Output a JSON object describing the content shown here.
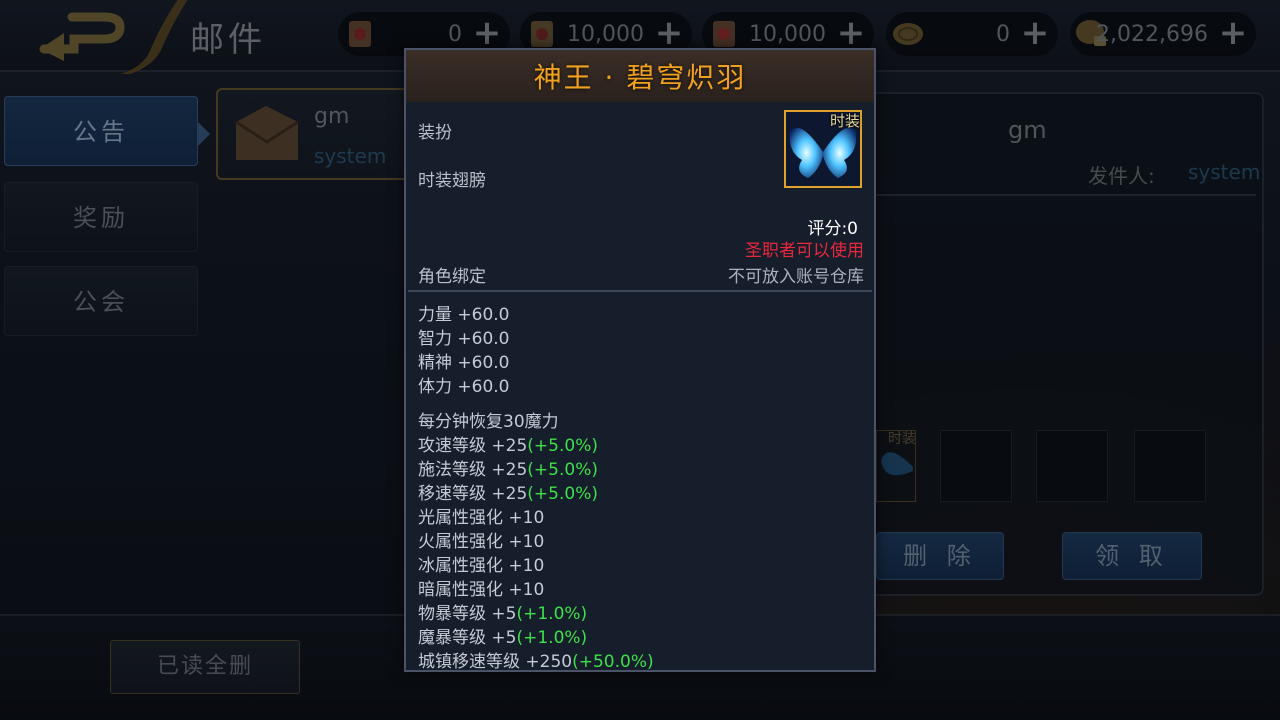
{
  "header": {
    "title": "邮件",
    "currencies": [
      {
        "icon": "scroll-red-icon",
        "value": "0"
      },
      {
        "icon": "scroll-gold-icon",
        "value": "10,000"
      },
      {
        "icon": "scroll-seal-icon",
        "value": "10,000"
      },
      {
        "icon": "coin-bronze-icon",
        "value": "0"
      },
      {
        "icon": "coin-lock-icon",
        "value": "2,022,696"
      }
    ],
    "plus": "+"
  },
  "tabs": [
    {
      "label": "公告",
      "active": true
    },
    {
      "label": "奖励",
      "active": false
    },
    {
      "label": "公会",
      "active": false
    }
  ],
  "mail_list": [
    {
      "title": "gm",
      "sender": "system"
    }
  ],
  "detail": {
    "title": "gm",
    "sender_label": "发件人:",
    "sender": "system",
    "attachment_tag": "时装",
    "delete_label": "删 除",
    "claim_label": "领 取"
  },
  "bottom": {
    "read_delete_label": "已读全删"
  },
  "tooltip": {
    "name": "神王 · 碧穹炽羽",
    "category": "装扮",
    "subtype": "时装翅膀",
    "icon_tag": "时装",
    "score": "评分:0",
    "class_req": "圣职者可以使用",
    "binding": "角色绑定",
    "storage": "不可放入账号仓库",
    "base_stats": [
      "力量 +60.0",
      "智力 +60.0",
      "精神 +60.0",
      "体力 +60.0"
    ],
    "extra_stats": [
      {
        "text": "每分钟恢复30魔力",
        "bonus": ""
      },
      {
        "text": "攻速等级 +25",
        "bonus": "(+5.0%)"
      },
      {
        "text": "施法等级 +25",
        "bonus": "(+5.0%)"
      },
      {
        "text": "移速等级 +25",
        "bonus": "(+5.0%)"
      },
      {
        "text": "光属性强化 +10",
        "bonus": ""
      },
      {
        "text": "火属性强化 +10",
        "bonus": ""
      },
      {
        "text": "冰属性强化 +10",
        "bonus": ""
      },
      {
        "text": "暗属性强化 +10",
        "bonus": ""
      },
      {
        "text": "物暴等级 +5",
        "bonus": "(+1.0%)"
      },
      {
        "text": "魔暴等级 +5",
        "bonus": "(+1.0%)"
      },
      {
        "text": "城镇移速等级 +250",
        "bonus": "(+50.0%)"
      }
    ]
  },
  "colors": {
    "title_orange": "#f2a11e",
    "warning_red": "#e8283c",
    "bonus_green": "#3ee04a",
    "icon_border": "#e0a22a"
  }
}
